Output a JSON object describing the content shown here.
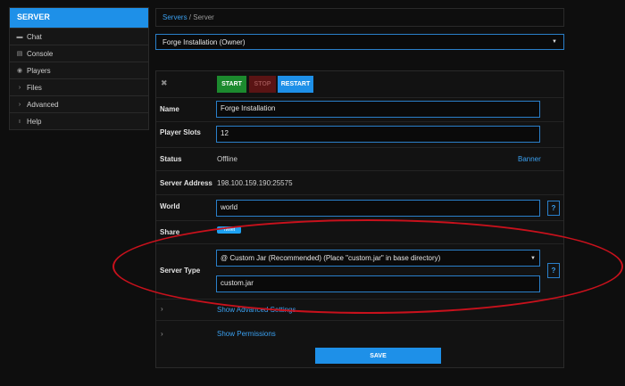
{
  "sidebar": {
    "header": "SERVER",
    "items": [
      {
        "label": "Chat",
        "icon": "chat-icon",
        "glyph": "▬"
      },
      {
        "label": "Console",
        "icon": "console-icon",
        "glyph": "▤"
      },
      {
        "label": "Players",
        "icon": "players-icon",
        "glyph": "◉"
      },
      {
        "label": "Files",
        "icon": "chevron-right-icon",
        "glyph": "›"
      },
      {
        "label": "Advanced",
        "icon": "chevron-right-icon",
        "glyph": "›"
      },
      {
        "label": "Help",
        "icon": "info-icon",
        "glyph": "ı"
      }
    ]
  },
  "breadcrumb": {
    "root": "Servers",
    "separator": "/",
    "current": "Server"
  },
  "server_select": {
    "value": "Forge Installation (Owner)"
  },
  "toolbar": {
    "start": "START",
    "stop": "STOP",
    "restart": "RESTART",
    "close_glyph": "✖"
  },
  "fields": {
    "name": {
      "label": "Name",
      "value": "Forge Installation"
    },
    "player_slots": {
      "label": "Player Slots",
      "value": "12"
    },
    "status": {
      "label": "Status",
      "value": "Offline",
      "banner": "Banner"
    },
    "server_address": {
      "label": "Server Address",
      "value": "198.100.159.190:25575"
    },
    "world": {
      "label": "World",
      "value": "world"
    },
    "share": {
      "label": "Share",
      "tweet": "Tweet"
    },
    "server_type": {
      "label": "Server Type",
      "selected": "@ Custom Jar (Recommended) (Place \"custom.jar\" in base directory)",
      "jar": "custom.jar"
    }
  },
  "help_glyph": "?",
  "expanders": {
    "advanced": "Show Advanced Settings",
    "permissions": "Show Permissions"
  },
  "save": "SAVE",
  "colors": {
    "accent": "#1e90e8",
    "start": "#1c8a2e",
    "stop": "#5a1414",
    "annotation": "#c8111c"
  }
}
